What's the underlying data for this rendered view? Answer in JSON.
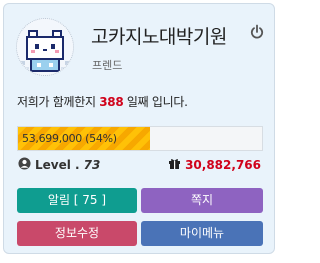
{
  "profile": {
    "name": "고카지노대박기원",
    "rank": "프렌드",
    "days_prefix": "저희가 함께한지",
    "days_count": "388",
    "days_suffix": "일째 입니다."
  },
  "experience": {
    "label": "53,699,000 (54%)",
    "fraction": 0.54,
    "fill_color": "#ffc107"
  },
  "level": {
    "label": "Level .",
    "value": "73"
  },
  "points": {
    "value": "30,882,766",
    "color": "#d0021b"
  },
  "buttons": {
    "alerts": "알림 [ 75 ]",
    "notes": "쪽지",
    "edit_profile": "정보수정",
    "my_menu": "마이메뉴"
  },
  "icons": {
    "power": "power-icon",
    "user": "user-icon",
    "gift": "gift-icon"
  }
}
